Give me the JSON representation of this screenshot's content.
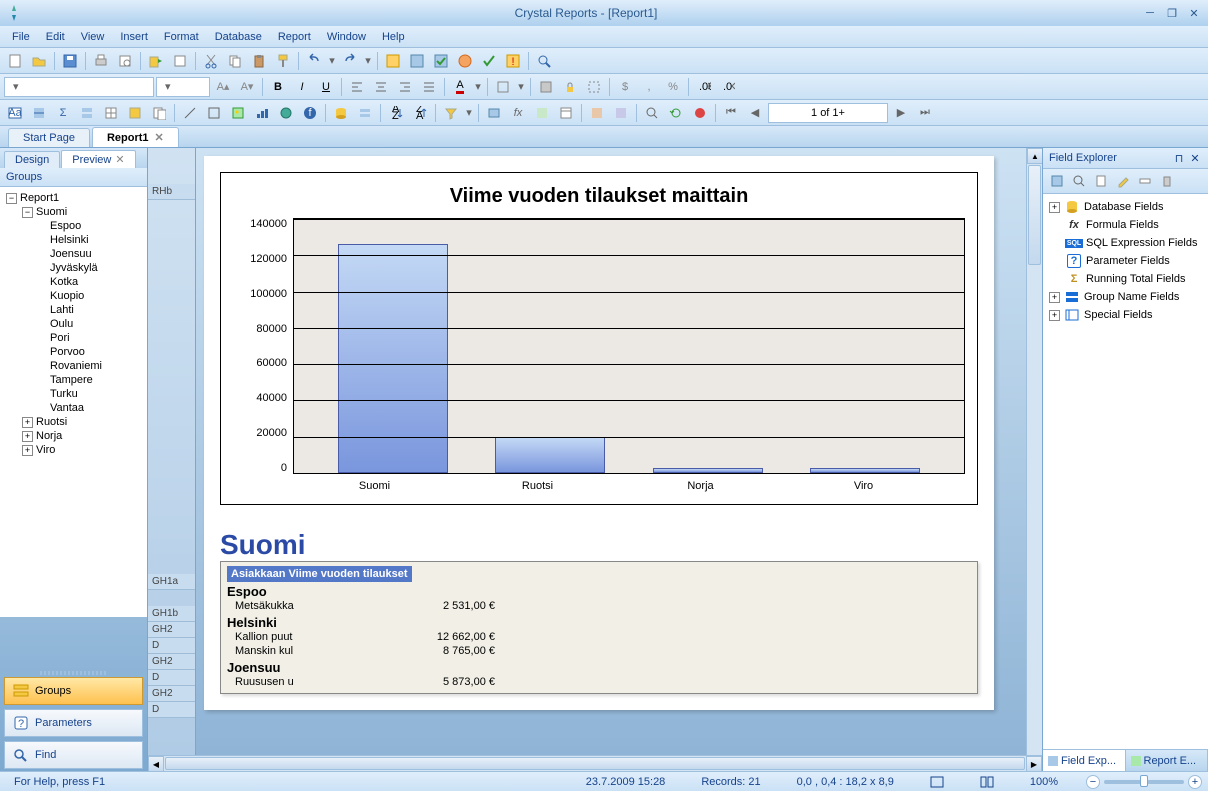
{
  "titlebar": {
    "title": "Crystal Reports - [Report1]"
  },
  "menu": [
    "File",
    "Edit",
    "View",
    "Insert",
    "Format",
    "Database",
    "Report",
    "Window",
    "Help"
  ],
  "doctabs": {
    "start": "Start Page",
    "report": "Report1"
  },
  "subtabs": {
    "design": "Design",
    "preview": "Preview"
  },
  "left": {
    "groups_hdr": "Groups",
    "tree_root": "Report1",
    "tree_suomi": "Suomi",
    "cities": [
      "Espoo",
      "Helsinki",
      "Joensuu",
      "Jyväskylä",
      "Kotka",
      "Kuopio",
      "Lahti",
      "Oulu",
      "Pori",
      "Porvoo",
      "Rovaniemi",
      "Tampere",
      "Turku",
      "Vantaa"
    ],
    "other_countries": [
      "Ruotsi",
      "Norja",
      "Viro"
    ],
    "nav_groups": "Groups",
    "nav_params": "Parameters",
    "nav_find": "Find"
  },
  "sections": {
    "RHb": "RHb",
    "GH1a": "GH1a",
    "GH1b": "GH1b",
    "GH2_1": "GH2",
    "D1": "D",
    "GH2_2": "GH2",
    "D2": "D",
    "GH2_3": "GH2",
    "D3": "D"
  },
  "chart_data": {
    "type": "bar",
    "title": "Viime vuoden tilaukset maittain",
    "categories": [
      "Suomi",
      "Ruotsi",
      "Norja",
      "Viro"
    ],
    "values": [
      126000,
      20000,
      3000,
      2500
    ],
    "ylim": [
      0,
      140000
    ],
    "yticks": [
      "140000",
      "120000",
      "100000",
      "80000",
      "60000",
      "40000",
      "20000",
      "0"
    ]
  },
  "report": {
    "group_title": "Suomi",
    "table_hdr_1": "Asiakkaan",
    "table_hdr_2": "Viime vuoden tilaukset",
    "rows": [
      {
        "type": "grp",
        "label": "Espoo"
      },
      {
        "type": "det",
        "c1": "Metsäkukka",
        "c2": "2 531,00 €"
      },
      {
        "type": "grp",
        "label": "Helsinki"
      },
      {
        "type": "det",
        "c1": "Kallion puut",
        "c2": "12 662,00 €"
      },
      {
        "type": "det",
        "c1": "Manskin kul",
        "c2": "8 765,00 €"
      },
      {
        "type": "grp",
        "label": "Joensuu"
      },
      {
        "type": "det",
        "c1": "Ruususen u",
        "c2": "5 873,00 €"
      }
    ]
  },
  "paging": {
    "label": "1 of 1+"
  },
  "right": {
    "hdr": "Field Explorer",
    "items": [
      {
        "exp": "+",
        "icon": "db",
        "label": "Database Fields",
        "color": "#f5c842"
      },
      {
        "exp": "",
        "icon": "fx",
        "label": "Formula Fields",
        "color": "#333"
      },
      {
        "exp": "",
        "icon": "sql",
        "label": "SQL Expression Fields",
        "color": "#1a6dd6"
      },
      {
        "exp": "",
        "icon": "?",
        "label": "Parameter Fields",
        "color": "#1a6dd6"
      },
      {
        "exp": "",
        "icon": "Σ",
        "label": "Running Total Fields",
        "color": "#c09020"
      },
      {
        "exp": "+",
        "icon": "grp",
        "label": "Group Name Fields",
        "color": "#1a6dd6"
      },
      {
        "exp": "+",
        "icon": "sp",
        "label": "Special Fields",
        "color": "#1a6dd6"
      }
    ],
    "tab1": "Field Exp...",
    "tab2": "Report E..."
  },
  "status": {
    "help": "For Help, press F1",
    "date": "23.7.2009  15:28",
    "records": "Records:  21",
    "coords": "0,0 , 0,4 : 18,2 x 8,9",
    "zoom": "100%"
  }
}
